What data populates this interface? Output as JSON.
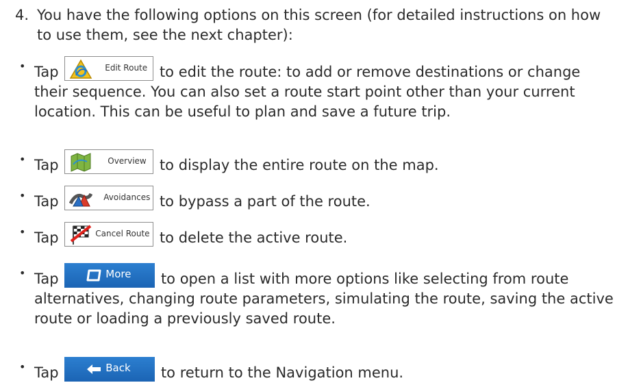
{
  "step": {
    "number": "4.",
    "text": "You have the following options on this screen (for detailed instructions on how to use them, see the next chapter):"
  },
  "items": [
    {
      "bullet": "•",
      "tap": "Tap",
      "button_label": "Edit Route",
      "button_icon": "edit-route-icon",
      "text": "to edit the route: to add or remove destinations or change their sequence. You can also set a route start point other than your current location. This can be useful to plan and save a future trip."
    },
    {
      "bullet": "•",
      "tap": "Tap",
      "button_label": "Overview",
      "button_icon": "overview-map-icon",
      "text": "to display the entire route on the map."
    },
    {
      "bullet": "•",
      "tap": "Tap",
      "button_label": "Avoidances",
      "button_icon": "avoidances-icon",
      "text": "to bypass a part of the route."
    },
    {
      "bullet": "•",
      "tap": "Tap",
      "button_label": "Cancel Route",
      "button_icon": "cancel-route-flag-icon",
      "text": "to delete the active route."
    },
    {
      "bullet": "•",
      "tap": "Tap",
      "button_label": "More",
      "button_icon": "more-icon",
      "text": "to open a list with more options like selecting from route alternatives, changing route parameters, simulating the route, saving the active route or loading a previously saved route."
    },
    {
      "bullet": "•",
      "tap": "Tap",
      "button_label": "Back",
      "button_icon": "back-arrow-icon",
      "text": "to return to the Navigation menu."
    }
  ],
  "colors": {
    "text": "#2a2a2a",
    "blue_button": "#1f6fc4",
    "button_border": "#8c8c8c"
  }
}
